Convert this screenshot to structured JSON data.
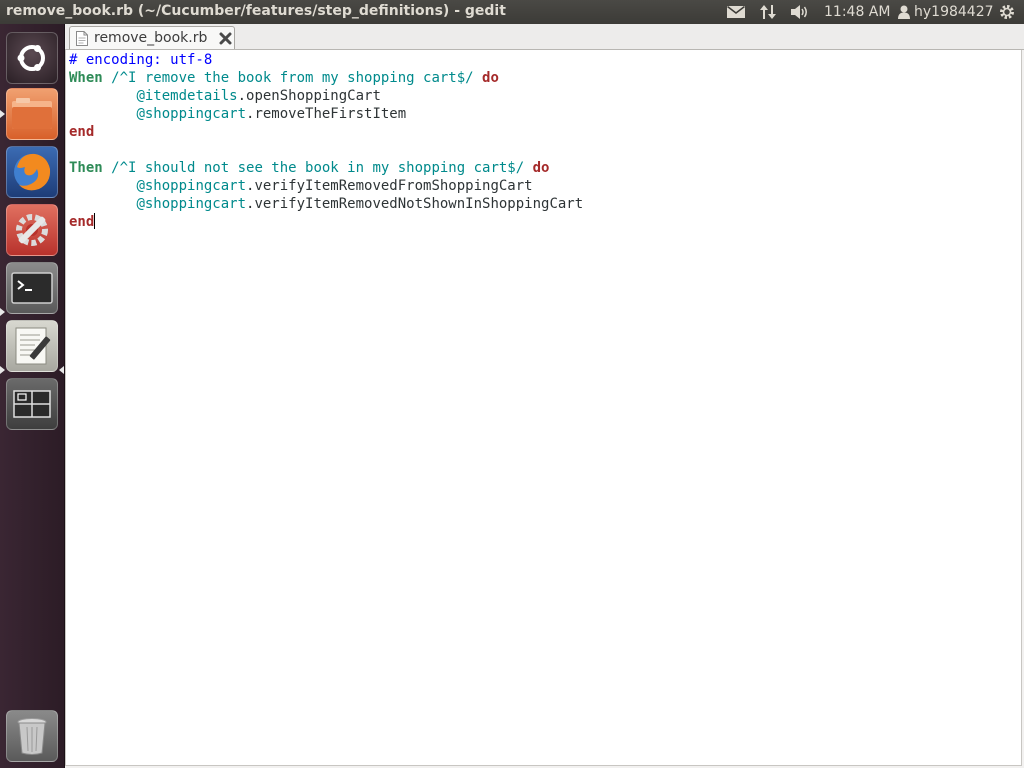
{
  "top_panel": {
    "window_title": "remove_book.rb (~/Cucumber/features/step_definitions) - gedit",
    "clock": "11:48 AM",
    "username": "hy1984427",
    "icons": [
      "mail-icon",
      "network-icon",
      "sound-icon",
      "user-icon",
      "gear-icon"
    ]
  },
  "launcher": {
    "items": [
      "dash-home",
      "files",
      "firefox",
      "system-settings",
      "terminal",
      "text-editor",
      "workspace-switcher",
      "trash"
    ]
  },
  "tabs": [
    {
      "label": "remove_book.rb",
      "active": true
    }
  ],
  "editor": {
    "lines": [
      {
        "parts": [
          {
            "t": "comment",
            "v": "# encoding: utf-8"
          }
        ]
      },
      {
        "parts": [
          {
            "t": "kw-step",
            "v": "When"
          },
          {
            "t": "plain",
            "v": " "
          },
          {
            "t": "regex",
            "v": "/^I remove the book from my shopping cart$/"
          },
          {
            "t": "plain",
            "v": " "
          },
          {
            "t": "kw",
            "v": "do"
          }
        ]
      },
      {
        "parts": [
          {
            "t": "plain",
            "v": "        "
          },
          {
            "t": "ivar",
            "v": "@itemdetails"
          },
          {
            "t": "plain",
            "v": ".openShoppingCart"
          }
        ]
      },
      {
        "parts": [
          {
            "t": "plain",
            "v": "        "
          },
          {
            "t": "ivar",
            "v": "@shoppingcart"
          },
          {
            "t": "plain",
            "v": ".removeTheFirstItem"
          }
        ]
      },
      {
        "parts": [
          {
            "t": "kw",
            "v": "end"
          }
        ]
      },
      {
        "parts": []
      },
      {
        "parts": [
          {
            "t": "kw-step",
            "v": "Then"
          },
          {
            "t": "plain",
            "v": " "
          },
          {
            "t": "regex",
            "v": "/^I should not see the book in my shopping cart$/"
          },
          {
            "t": "plain",
            "v": " "
          },
          {
            "t": "kw",
            "v": "do"
          }
        ]
      },
      {
        "parts": [
          {
            "t": "plain",
            "v": "        "
          },
          {
            "t": "ivar",
            "v": "@shoppingcart"
          },
          {
            "t": "plain",
            "v": ".verifyItemRemovedFromShoppingCart"
          }
        ]
      },
      {
        "parts": [
          {
            "t": "plain",
            "v": "        "
          },
          {
            "t": "ivar",
            "v": "@shoppingcart"
          },
          {
            "t": "plain",
            "v": ".verifyItemRemovedNotShownInShoppingCart"
          }
        ]
      },
      {
        "parts": [
          {
            "t": "kw",
            "v": "end"
          }
        ],
        "caret": true
      }
    ]
  }
}
